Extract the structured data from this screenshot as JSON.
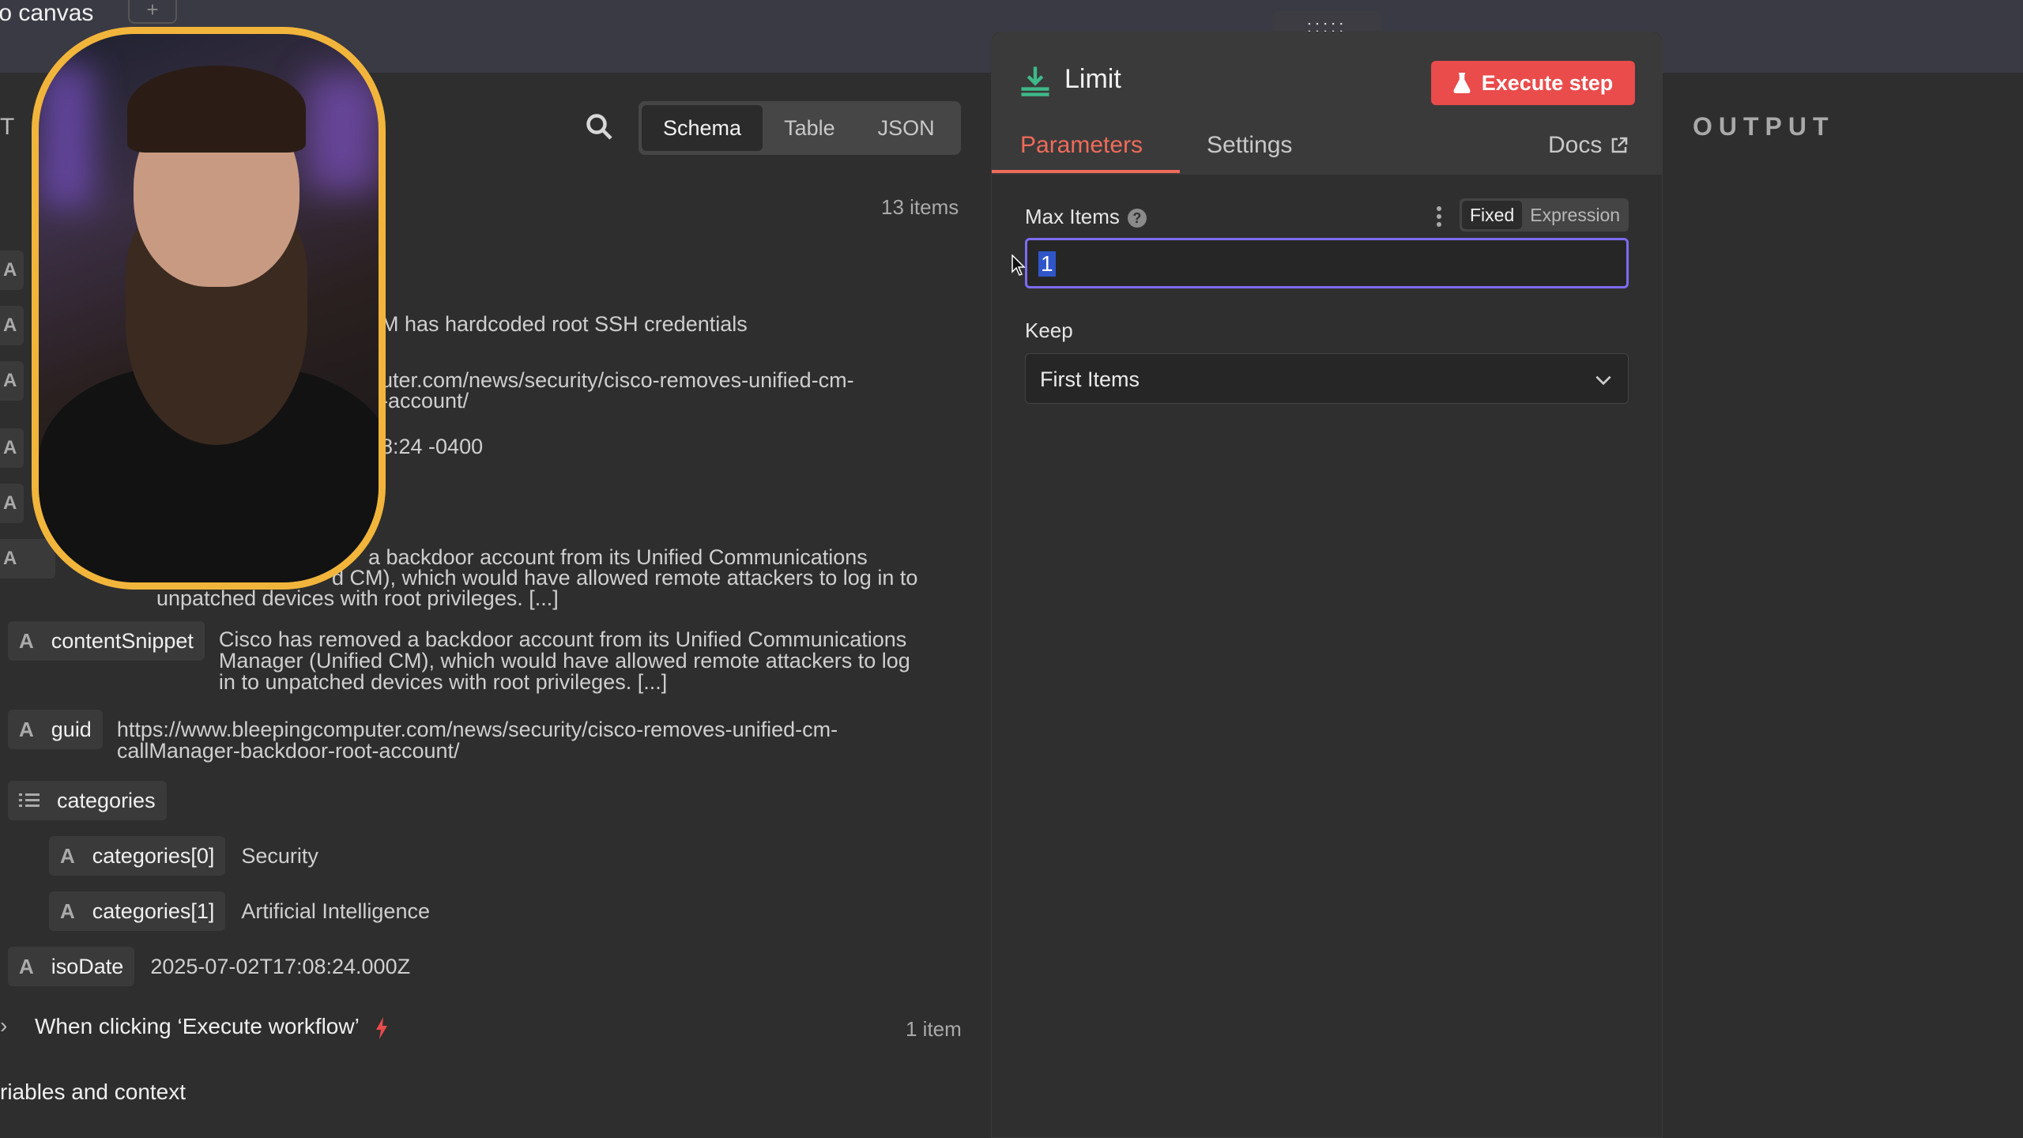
{
  "topbar": {
    "back_label": "to canvas",
    "add_label": "+"
  },
  "input_panel": {
    "title_fragment": "T",
    "view_modes": [
      "Schema",
      "Table",
      "JSON"
    ],
    "active_view": "Schema",
    "item_count": "13 items",
    "fragments": {
      "title_tail": "M has hardcoded root SSH credentials",
      "link_line1": "uter.com/news/security/cisco-removes-unified-cm-",
      "link_line2": "-account/",
      "date_tail": "8:24 -0400",
      "content_line1": "a backdoor account from its Unified Communications",
      "content_line2": "d CM), which would have allowed remote attackers to log in to",
      "content_line3": "unpatched devices with root privileges. [...]"
    },
    "fields": {
      "contentSnippet": {
        "key": "contentSnippet",
        "value": [
          "Cisco has removed a backdoor account from its Unified Communications",
          "Manager (Unified CM), which would have allowed remote attackers to log",
          "in to unpatched devices with root privileges. [...]"
        ]
      },
      "guid": {
        "key": "guid",
        "value": [
          "https://www.bleepingcomputer.com/news/security/cisco-removes-unified-cm-",
          "callManager-backdoor-root-account/"
        ]
      },
      "categories": {
        "key": "categories"
      },
      "categories0": {
        "key": "categories[0]",
        "value": "Security"
      },
      "categories1": {
        "key": "categories[1]",
        "value": "Artificial Intelligence"
      },
      "isoDate": {
        "key": "isoDate",
        "value": "2025-07-02T17:08:24.000Z"
      }
    },
    "trigger": {
      "label": "When clicking ‘Execute workflow’",
      "count": "1 item"
    },
    "variables_label": "riables and context"
  },
  "ndv": {
    "drag_handle": ":::::",
    "node_title": "Limit",
    "execute_label": "Execute step",
    "tabs": {
      "parameters": "Parameters",
      "settings": "Settings",
      "docs": "Docs"
    },
    "max_items": {
      "label": "Max Items",
      "help": "?",
      "mode_fixed": "Fixed",
      "mode_expression": "Expression",
      "value": "1"
    },
    "keep": {
      "label": "Keep",
      "value": "First Items"
    }
  },
  "output_panel": {
    "label": "OUTPUT"
  },
  "colors": {
    "accent": "#ea4b4b",
    "tab_active": "#ef6b5a",
    "webcam_border": "#f2b53b",
    "input_focus": "#7c6cf0"
  }
}
